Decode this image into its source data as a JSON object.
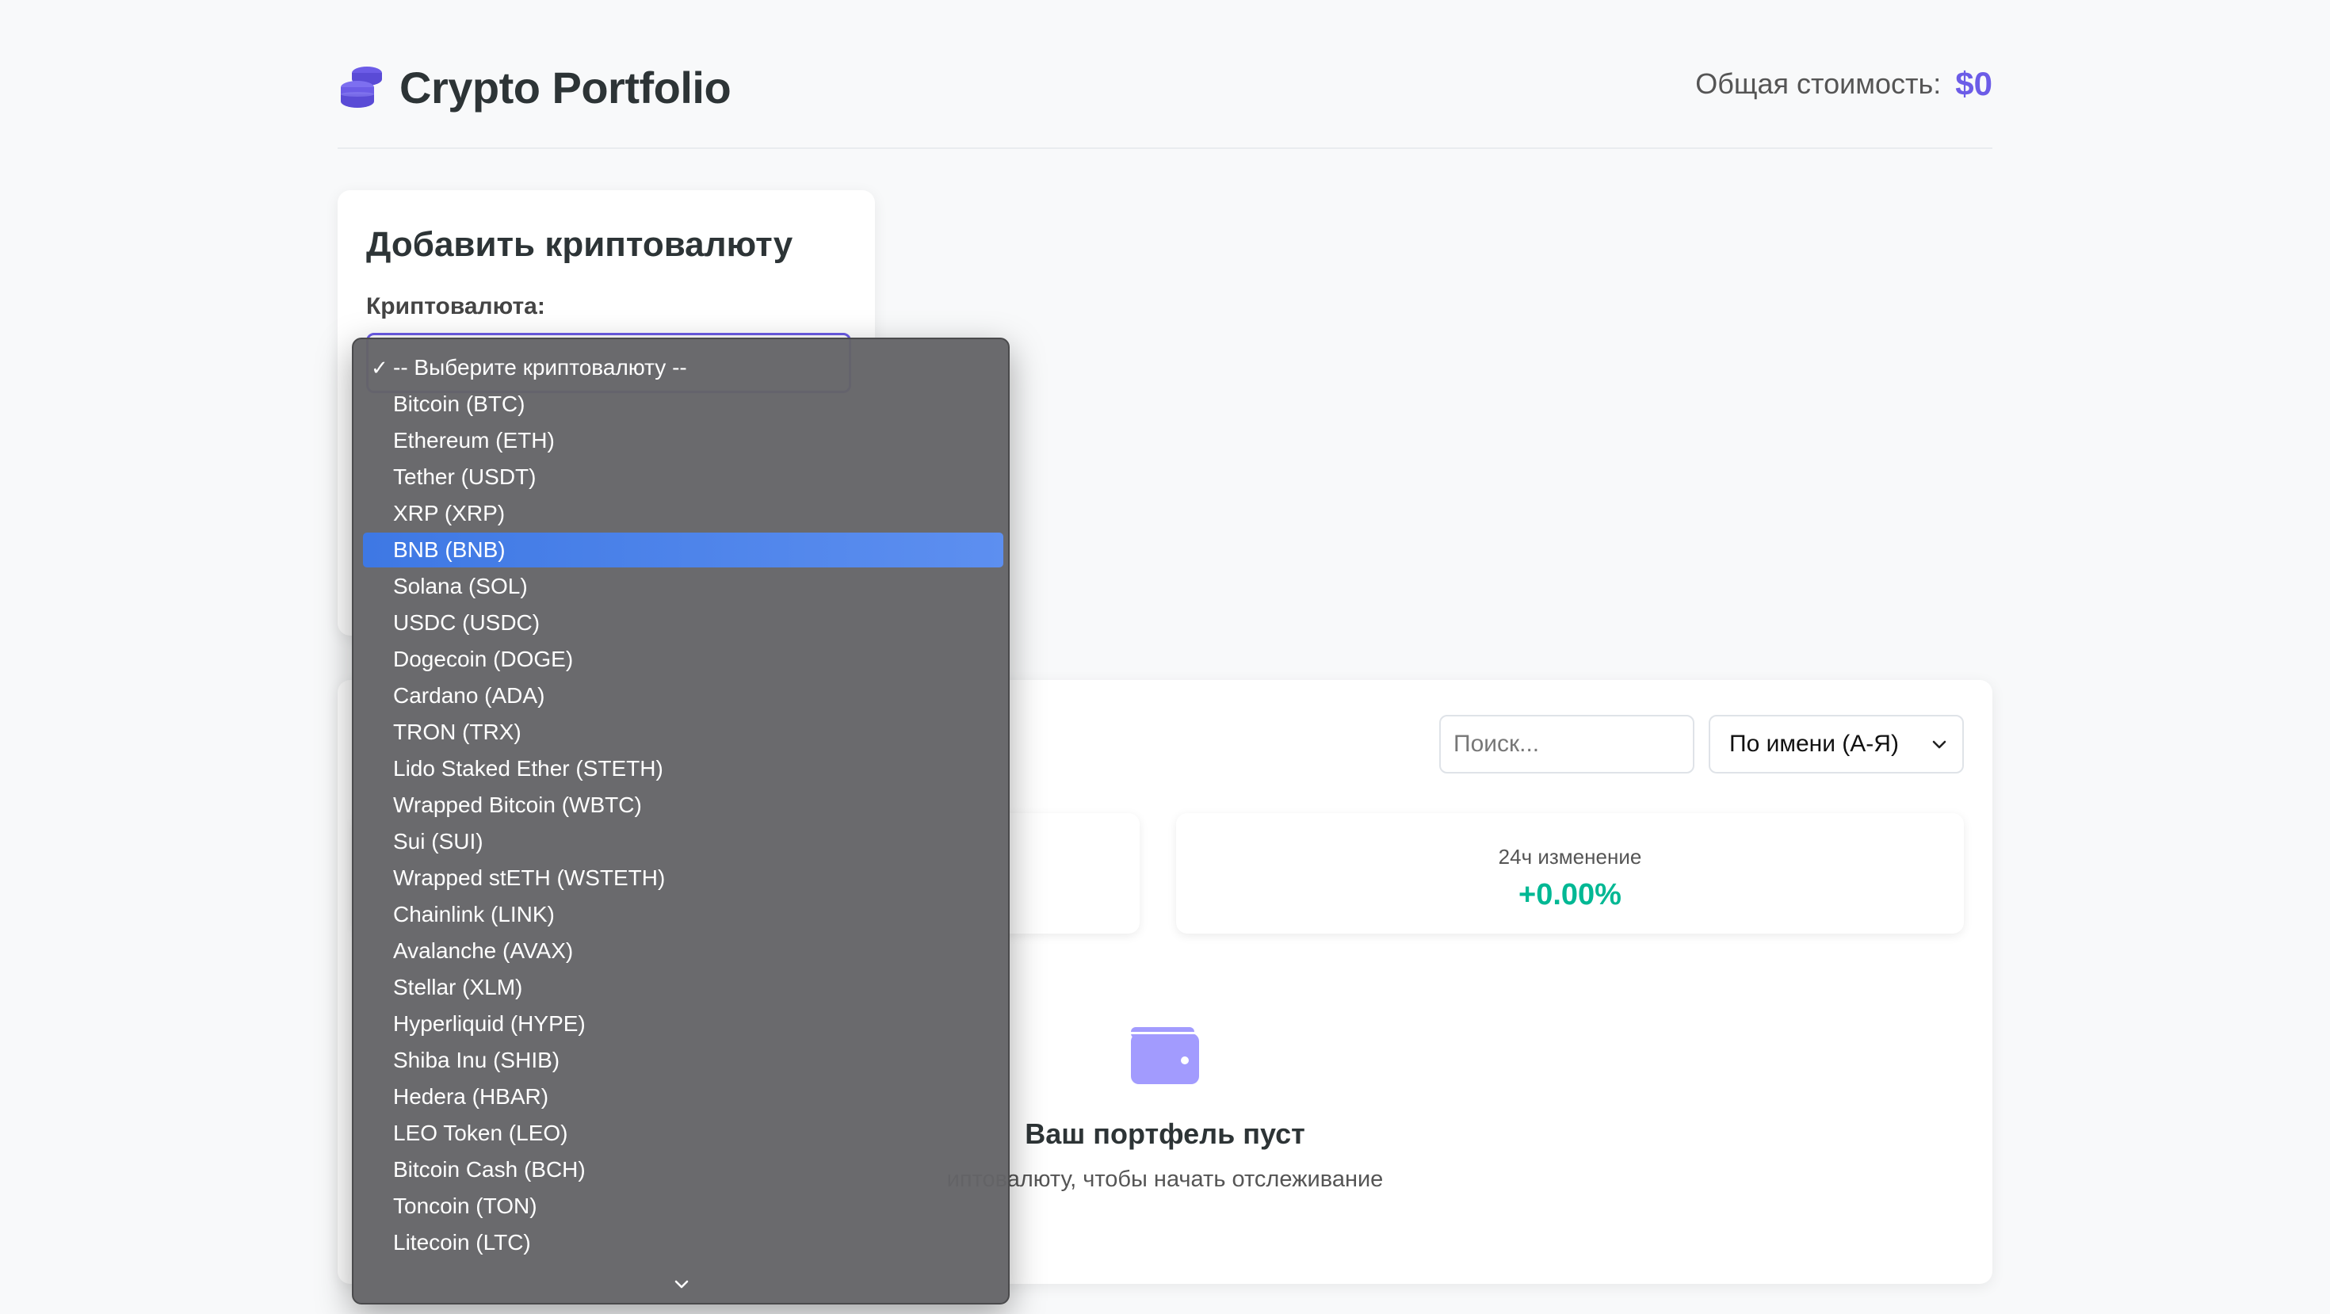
{
  "header": {
    "title": "Crypto Portfolio",
    "total_label": "Общая стоимость:",
    "total_value": "$0",
    "icon": "coins-icon"
  },
  "add_form": {
    "title": "Добавить криптовалюту",
    "crypto_label": "Криптовалюта:"
  },
  "portfolio": {
    "search_placeholder": "Поиск...",
    "sort_selected": "По имени (А-Я)",
    "stats": [
      {
        "label": "24ч изменение",
        "value": "+0.00%",
        "color": "#00b894"
      }
    ],
    "empty_icon": "wallet-icon",
    "empty_title": "Ваш портфель пуст",
    "empty_subtitle": "иптовалюту, чтобы начать отслеживание"
  },
  "dropdown": {
    "selected_index": 0,
    "highlighted_index": 5,
    "options": [
      "-- Выберите криптовалюту --",
      "Bitcoin (BTC)",
      "Ethereum (ETH)",
      "Tether (USDT)",
      "XRP (XRP)",
      "BNB (BNB)",
      "Solana (SOL)",
      "USDC (USDC)",
      "Dogecoin (DOGE)",
      "Cardano (ADA)",
      "TRON (TRX)",
      "Lido Staked Ether (STETH)",
      "Wrapped Bitcoin (WBTC)",
      "Sui (SUI)",
      "Wrapped stETH (WSTETH)",
      "Chainlink (LINK)",
      "Avalanche (AVAX)",
      "Stellar (XLM)",
      "Hyperliquid (HYPE)",
      "Shiba Inu (SHIB)",
      "Hedera (HBAR)",
      "LEO Token (LEO)",
      "Bitcoin Cash (BCH)",
      "Toncoin (TON)",
      "Litecoin (LTC)"
    ],
    "check_glyph": "✓",
    "scroll_icon": "chevron-down-icon"
  },
  "colors": {
    "accent": "#6c5ce7",
    "positive": "#00b894",
    "highlight": "#3e78e4",
    "wallet": "#a29bfe"
  }
}
